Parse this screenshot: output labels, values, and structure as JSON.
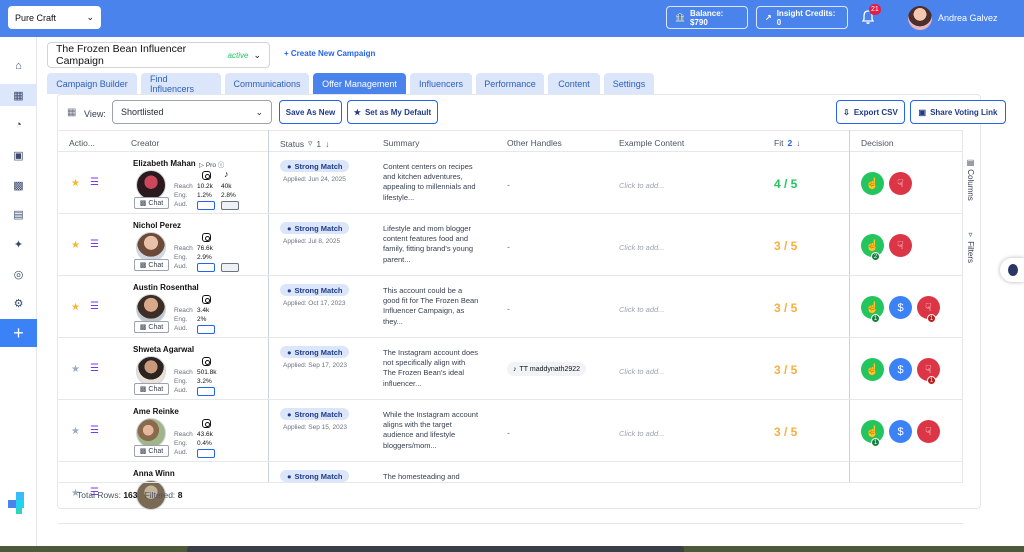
{
  "topbar": {
    "workspace": "Pure Craft",
    "balance": "Balance: $790",
    "insight_credits": "Insight Credits: 0",
    "notifications": "21",
    "user_name": "Andrea Galvez"
  },
  "campaign": {
    "name": "The Frozen Bean Influencer Campaign",
    "status": "active",
    "create_new": "Create New Campaign"
  },
  "tabs": [
    {
      "label": "Campaign Builder"
    },
    {
      "label": "Find Influencers"
    },
    {
      "label": "Communications"
    },
    {
      "label": "Offer Management",
      "active": true
    },
    {
      "label": "Influencers"
    },
    {
      "label": "Performance"
    },
    {
      "label": "Content"
    },
    {
      "label": "Settings"
    }
  ],
  "toolbar": {
    "view_label": "View:",
    "view_value": "Shortlisted",
    "save_as_new": "Save As New",
    "set_default": "Set as My Default",
    "export_csv": "Export CSV",
    "share_voting": "Share Voting Link"
  },
  "columns": {
    "actions": "Actio...",
    "creator": "Creator",
    "status": "Status",
    "status_filter_count": "1",
    "summary": "Summary",
    "other_handles": "Other Handles",
    "example_content": "Example Content",
    "fit": "Fit",
    "fit_sort": "2",
    "decision": "Decision"
  },
  "side_rail": {
    "columns": "Columns",
    "filters": "Filters"
  },
  "labels": {
    "reach": "Reach",
    "eng": "Eng.",
    "aud": "Aud.",
    "chat": "Chat",
    "pro": "Pro",
    "placeholder_example": "Click to add...",
    "dash": "-"
  },
  "rows": [
    {
      "name": "Elizabeth Mahan",
      "starred": true,
      "pro": true,
      "reach": "10.2k",
      "reach2": "40k",
      "eng": "1.2%",
      "eng2": "2.8%",
      "status": "Strong Match",
      "applied": "Applied: Jun 24, 2025",
      "summary": "Content centers on recipes and kitchen adventures, appealing to millennials and lifestyle...",
      "handle": "",
      "fit": "4 / 5",
      "fit_color": "green",
      "decision": {
        "up_badge": "",
        "mid": false,
        "down_badge": ""
      }
    },
    {
      "name": "Nichol Perez",
      "starred": true,
      "pro": false,
      "reach": "76.6k",
      "reach2": "",
      "eng": "2.9%",
      "eng2": "",
      "status": "Strong Match",
      "applied": "Applied: Jul 8, 2025",
      "summary": "Lifestyle and mom blogger content features food and family, fitting brand's young parent...",
      "handle": "",
      "fit": "3 / 5",
      "fit_color": "orange",
      "decision": {
        "up_badge": "2",
        "mid": false,
        "down_badge": ""
      }
    },
    {
      "name": "Austin Rosenthal",
      "starred": true,
      "pro": false,
      "reach": "3.4k",
      "reach2": "",
      "eng": "2%",
      "eng2": "",
      "status": "Strong Match",
      "applied": "Applied: Oct 17, 2023",
      "summary": "This account could be a good fit for The Frozen Bean Influencer Campaign, as they...",
      "handle": "",
      "fit": "3 / 5",
      "fit_color": "orange",
      "decision": {
        "up_badge": "1",
        "mid": true,
        "down_badge": "1"
      }
    },
    {
      "name": "Shweta Agarwal",
      "starred": false,
      "pro": false,
      "reach": "501.8k",
      "reach2": "",
      "eng": "3.2%",
      "eng2": "",
      "status": "Strong Match",
      "applied": "Applied: Sep 17, 2023",
      "summary": "The Instagram account does not specifically align with The Frozen Bean's ideal influencer...",
      "handle": "TT maddynath2922",
      "fit": "3 / 5",
      "fit_color": "orange",
      "decision": {
        "up_badge": "",
        "mid": true,
        "down_badge": "1"
      }
    },
    {
      "name": "Ame Reinke",
      "starred": false,
      "pro": false,
      "reach": "43.6k",
      "reach2": "",
      "eng": "0.4%",
      "eng2": "",
      "status": "Strong Match",
      "applied": "Applied: Sep 15, 2023",
      "summary": "While the Instagram account aligns with the target audience and lifestyle bloggers/mom...",
      "handle": "",
      "fit": "3 / 5",
      "fit_color": "orange",
      "decision": {
        "up_badge": "1",
        "mid": true,
        "down_badge": ""
      }
    },
    {
      "name": "Anna Winn",
      "starred": false,
      "pro": false,
      "reach": "",
      "reach2": "",
      "eng": "",
      "eng2": "",
      "status": "Strong Match",
      "applied": "",
      "summary": "The homesteading and",
      "handle": "",
      "fit": "",
      "fit_color": "orange",
      "decision": {
        "up_badge": "",
        "mid": false,
        "down_badge": ""
      }
    }
  ],
  "footer": {
    "total_label": "Total Rows:",
    "total_value": "163",
    "filtered_label": "Filtered:",
    "filtered_value": "8"
  },
  "colors": {
    "primary": "#4a83ec",
    "green": "#22c55e",
    "red": "#dc3545",
    "orange": "#f5b040"
  }
}
